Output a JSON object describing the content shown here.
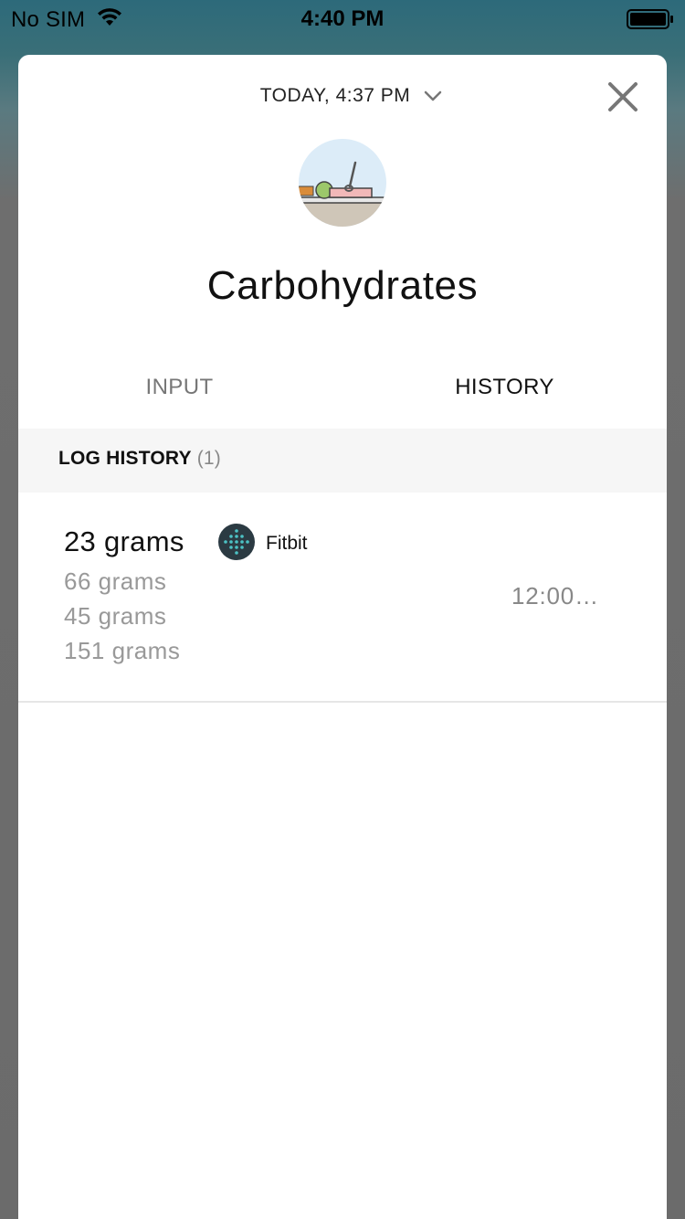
{
  "status_bar": {
    "carrier": "No SIM",
    "time": "4:40 PM"
  },
  "header": {
    "date_label": "TODAY, 4:37 PM",
    "title": "Carbohydrates"
  },
  "tabs": [
    {
      "label": "INPUT",
      "active": false
    },
    {
      "label": "HISTORY",
      "active": true
    }
  ],
  "section": {
    "title": "LOG HISTORY",
    "count": "(1)"
  },
  "log_entries": [
    {
      "primary": "23 grams",
      "secondary": [
        "66 grams",
        "45 grams",
        "151 grams"
      ],
      "source": "Fitbit",
      "source_icon": "fitbit-logo-icon",
      "time": "12:00…"
    }
  ],
  "colors": {
    "background_teal": "#2d6a7a",
    "sheet": "#ffffff",
    "section_bg": "#f6f6f6",
    "muted_text": "#999999",
    "fitbit_dark": "#2b3a42",
    "fitbit_teal": "#4cc2c4"
  }
}
